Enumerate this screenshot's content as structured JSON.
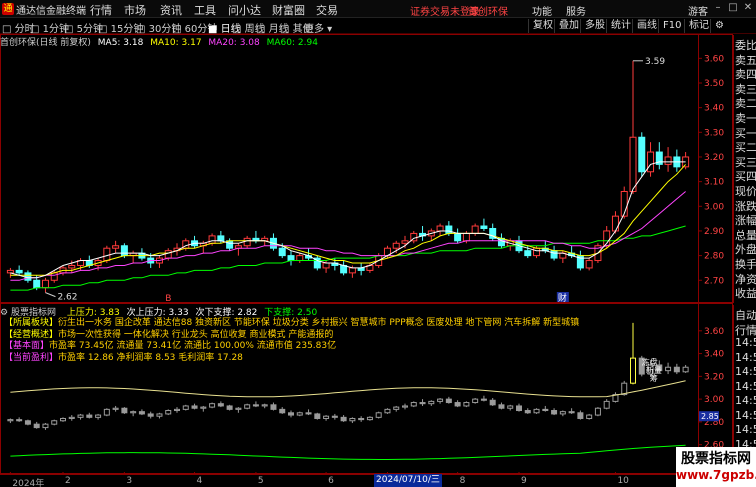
{
  "titlebar": {
    "app_title": "通达信金融终端",
    "menus": [
      "行情",
      "市场",
      "资讯",
      "工具",
      "问小达",
      "财富圈",
      "交易"
    ],
    "login_status": "证券交易未登录",
    "stock_title": "首创环保",
    "right_menus": [
      "功能",
      "服务",
      "游客"
    ],
    "window_buttons": [
      "minimize-icon",
      "restore-icon",
      "close-icon"
    ]
  },
  "toolbar": {
    "periods": [
      "分时",
      "1分钟",
      "5分钟",
      "15分钟",
      "30分钟",
      "60分钟",
      "日线",
      "周线",
      "月线",
      "其他",
      "更多"
    ],
    "active_period": "日线",
    "right_buttons": [
      "复权",
      "叠加",
      "多股",
      "统计",
      "画线",
      "F10",
      "标记"
    ]
  },
  "main_chart": {
    "header_name": "首创环保(日线 前复权)",
    "ma_labels": [
      {
        "text": "MA5: 3.18",
        "color": "#ffffff"
      },
      {
        "text": "MA10: 3.17",
        "color": "#ffff00"
      },
      {
        "text": "MA20: 3.08",
        "color": "#ff44ff"
      },
      {
        "text": "MA60: 2.94",
        "color": "#00ff00"
      }
    ],
    "y_ticks": [
      "3.60",
      "3.50",
      "3.40",
      "3.30",
      "3.20",
      "3.10",
      "3.00",
      "2.90",
      "2.80",
      "2.70"
    ],
    "high_label": "3.59",
    "low_label": "2.62",
    "markers": [
      "B",
      "财"
    ]
  },
  "indicator": {
    "header_name": "股票指标网",
    "labels": [
      {
        "text": "上压力: 3.83",
        "color": "#ffff00"
      },
      {
        "text": "次上压力: 3.33",
        "color": "#ffffff"
      },
      {
        "text": "次下支撑: 2.82",
        "color": "#ffffff"
      },
      {
        "text": "下支撑: 2.50",
        "color": "#00ff00"
      }
    ],
    "y_ticks": [
      "3.60",
      "3.40",
      "3.20",
      "3.00",
      "2.80",
      "2.60",
      "2.40"
    ],
    "cur_value": "2.85",
    "chip_labels": [
      "冻盘",
      "新量",
      "筹"
    ]
  },
  "info_box": [
    {
      "tag": "【所属板块】",
      "text": "衍生出一水务 国企改革 通达信88 独资新区 节能环保 垃圾分类 乡村振兴 智慧城市 PPP概念 医废处理 地下管网 汽车拆解 新型城镇",
      "tag_color": "#ffff00",
      "text_color": "#ffd000"
    },
    {
      "tag": "【经营概述】",
      "text": "市场一次性获得 一体化解决 行业龙头 高位收复 商业模式 产能通报的",
      "tag_color": "#ffff00",
      "text_color": "#ffd000"
    },
    {
      "tag": "【基本面】",
      "text": "市盈率 73.45亿 流通量 73.41亿 流通比 100.00% 流通市值 235.83亿",
      "tag_color": "#ff44ff",
      "text_color": "#ffd000"
    },
    {
      "tag": "【当前盈利】",
      "text": "市盈率 12.86 净利润率 8.53 毛利润率 17.28",
      "tag_color": "#ff44ff",
      "text_color": "#ffd000"
    }
  ],
  "quote_panel": [
    "委比",
    "卖五",
    "卖四",
    "卖三",
    "卖二",
    "卖一",
    "买一",
    "买二",
    "买三",
    "买四",
    "现价",
    "涨跌",
    "涨幅",
    "总量",
    "外盘",
    "换手",
    "净资",
    "收益"
  ],
  "tick_panel": [
    "自动",
    "行情",
    "14:56",
    "14:56",
    "14:56",
    "14:56",
    "14:56",
    "14:56",
    "14:56",
    "14:56",
    "14:56"
  ],
  "date_axis": {
    "labels": [
      "2024年",
      "2",
      "3",
      "4",
      "5",
      "6",
      "7",
      "8",
      "9",
      "10"
    ],
    "marker": "2024/07/10/三"
  },
  "watermark": {
    "name": "股票指标网",
    "url": "www.7gpzb.com"
  },
  "colors": {
    "up": "#ff3b3b",
    "down": "#54ffff",
    "grid": "#8b0000",
    "ma5": "#ffffff",
    "ma10": "#ffff00",
    "ma20": "#ff44ff",
    "ma60": "#00ff00"
  },
  "series": {
    "kline": [
      [
        2.73,
        2.75,
        2.71,
        2.74
      ],
      [
        2.74,
        2.76,
        2.72,
        2.73
      ],
      [
        2.73,
        2.74,
        2.69,
        2.7
      ],
      [
        2.7,
        2.72,
        2.66,
        2.67
      ],
      [
        2.67,
        2.71,
        2.65,
        2.7
      ],
      [
        2.7,
        2.74,
        2.69,
        2.73
      ],
      [
        2.73,
        2.76,
        2.72,
        2.75
      ],
      [
        2.75,
        2.78,
        2.73,
        2.76
      ],
      [
        2.76,
        2.79,
        2.74,
        2.78
      ],
      [
        2.78,
        2.8,
        2.75,
        2.76
      ],
      [
        2.76,
        2.79,
        2.74,
        2.78
      ],
      [
        2.78,
        2.84,
        2.77,
        2.83
      ],
      [
        2.83,
        2.86,
        2.81,
        2.84
      ],
      [
        2.84,
        2.85,
        2.79,
        2.8
      ],
      [
        2.8,
        2.82,
        2.77,
        2.81
      ],
      [
        2.81,
        2.83,
        2.78,
        2.79
      ],
      [
        2.79,
        2.81,
        2.75,
        2.77
      ],
      [
        2.77,
        2.8,
        2.75,
        2.79
      ],
      [
        2.79,
        2.83,
        2.78,
        2.82
      ],
      [
        2.82,
        2.85,
        2.8,
        2.83
      ],
      [
        2.83,
        2.87,
        2.82,
        2.86
      ],
      [
        2.86,
        2.88,
        2.83,
        2.84
      ],
      [
        2.84,
        2.86,
        2.81,
        2.85
      ],
      [
        2.85,
        2.89,
        2.84,
        2.88
      ],
      [
        2.88,
        2.9,
        2.85,
        2.86
      ],
      [
        2.86,
        2.87,
        2.82,
        2.83
      ],
      [
        2.83,
        2.85,
        2.8,
        2.84
      ],
      [
        2.84,
        2.88,
        2.83,
        2.87
      ],
      [
        2.87,
        2.9,
        2.85,
        2.86
      ],
      [
        2.86,
        2.88,
        2.84,
        2.87
      ],
      [
        2.87,
        2.89,
        2.82,
        2.83
      ],
      [
        2.83,
        2.85,
        2.79,
        2.8
      ],
      [
        2.8,
        2.82,
        2.76,
        2.78
      ],
      [
        2.78,
        2.81,
        2.77,
        2.8
      ],
      [
        2.8,
        2.83,
        2.78,
        2.79
      ],
      [
        2.79,
        2.8,
        2.74,
        2.75
      ],
      [
        2.75,
        2.78,
        2.73,
        2.77
      ],
      [
        2.77,
        2.79,
        2.74,
        2.76
      ],
      [
        2.76,
        2.78,
        2.72,
        2.73
      ],
      [
        2.73,
        2.76,
        2.71,
        2.75
      ],
      [
        2.75,
        2.77,
        2.72,
        2.74
      ],
      [
        2.74,
        2.77,
        2.73,
        2.76
      ],
      [
        2.76,
        2.81,
        2.75,
        2.8
      ],
      [
        2.8,
        2.84,
        2.79,
        2.83
      ],
      [
        2.83,
        2.86,
        2.81,
        2.85
      ],
      [
        2.85,
        2.88,
        2.83,
        2.86
      ],
      [
        2.86,
        2.9,
        2.85,
        2.89
      ],
      [
        2.89,
        2.92,
        2.86,
        2.88
      ],
      [
        2.88,
        2.91,
        2.86,
        2.9
      ],
      [
        2.9,
        2.93,
        2.88,
        2.92
      ],
      [
        2.92,
        2.94,
        2.88,
        2.89
      ],
      [
        2.89,
        2.91,
        2.85,
        2.86
      ],
      [
        2.86,
        2.9,
        2.85,
        2.89
      ],
      [
        2.89,
        2.93,
        2.88,
        2.92
      ],
      [
        2.92,
        2.95,
        2.9,
        2.91
      ],
      [
        2.91,
        2.93,
        2.86,
        2.87
      ],
      [
        2.87,
        2.89,
        2.83,
        2.84
      ],
      [
        2.84,
        2.87,
        2.82,
        2.86
      ],
      [
        2.86,
        2.88,
        2.81,
        2.82
      ],
      [
        2.82,
        2.84,
        2.79,
        2.8
      ],
      [
        2.8,
        2.84,
        2.79,
        2.83
      ],
      [
        2.83,
        2.86,
        2.81,
        2.82
      ],
      [
        2.82,
        2.84,
        2.78,
        2.79
      ],
      [
        2.79,
        2.82,
        2.77,
        2.81
      ],
      [
        2.81,
        2.84,
        2.79,
        2.8
      ],
      [
        2.8,
        2.82,
        2.74,
        2.75
      ],
      [
        2.75,
        2.79,
        2.74,
        2.78
      ],
      [
        2.78,
        2.85,
        2.77,
        2.84
      ],
      [
        2.84,
        2.92,
        2.83,
        2.9
      ],
      [
        2.9,
        2.98,
        2.89,
        2.96
      ],
      [
        2.96,
        3.08,
        2.95,
        3.06
      ],
      [
        3.06,
        3.59,
        3.05,
        3.28
      ],
      [
        3.28,
        3.3,
        3.12,
        3.14
      ],
      [
        3.14,
        3.26,
        3.12,
        3.22
      ],
      [
        3.22,
        3.26,
        3.15,
        3.17
      ],
      [
        3.17,
        3.24,
        3.14,
        3.2
      ],
      [
        3.2,
        3.23,
        3.14,
        3.16
      ],
      [
        3.16,
        3.22,
        3.15,
        3.2
      ]
    ],
    "ma5": [
      2.73,
      2.72,
      2.71,
      2.71,
      2.72,
      2.74,
      2.76,
      2.77,
      2.78,
      2.78,
      2.79,
      2.8,
      2.81,
      2.81,
      2.81,
      2.81,
      2.8,
      2.8,
      2.81,
      2.82,
      2.84,
      2.85,
      2.85,
      2.86,
      2.86,
      2.85,
      2.85,
      2.86,
      2.86,
      2.86,
      2.85,
      2.84,
      2.82,
      2.81,
      2.8,
      2.78,
      2.77,
      2.77,
      2.76,
      2.75,
      2.75,
      2.76,
      2.78,
      2.8,
      2.82,
      2.84,
      2.87,
      2.88,
      2.89,
      2.9,
      2.9,
      2.89,
      2.89,
      2.89,
      2.89,
      2.88,
      2.86,
      2.85,
      2.84,
      2.83,
      2.82,
      2.82,
      2.81,
      2.81,
      2.8,
      2.79,
      2.79,
      2.81,
      2.85,
      2.9,
      2.97,
      3.07,
      3.12,
      3.17,
      3.18,
      3.18,
      3.18,
      3.18
    ],
    "ma10": [
      2.72,
      2.72,
      2.72,
      2.72,
      2.72,
      2.73,
      2.74,
      2.74,
      2.75,
      2.76,
      2.77,
      2.78,
      2.79,
      2.8,
      2.8,
      2.8,
      2.8,
      2.81,
      2.81,
      2.82,
      2.83,
      2.83,
      2.84,
      2.85,
      2.85,
      2.86,
      2.86,
      2.86,
      2.86,
      2.86,
      2.85,
      2.84,
      2.83,
      2.82,
      2.81,
      2.8,
      2.79,
      2.78,
      2.78,
      2.77,
      2.77,
      2.77,
      2.78,
      2.79,
      2.8,
      2.82,
      2.83,
      2.85,
      2.86,
      2.88,
      2.89,
      2.89,
      2.89,
      2.89,
      2.89,
      2.88,
      2.87,
      2.86,
      2.85,
      2.84,
      2.83,
      2.83,
      2.82,
      2.82,
      2.81,
      2.8,
      2.8,
      2.81,
      2.83,
      2.86,
      2.89,
      2.94,
      2.98,
      3.02,
      3.06,
      3.1,
      3.13,
      3.17
    ],
    "ma20": [
      2.7,
      2.7,
      2.71,
      2.71,
      2.72,
      2.72,
      2.73,
      2.73,
      2.74,
      2.74,
      2.75,
      2.75,
      2.76,
      2.76,
      2.77,
      2.77,
      2.78,
      2.78,
      2.79,
      2.79,
      2.8,
      2.8,
      2.81,
      2.81,
      2.82,
      2.82,
      2.83,
      2.83,
      2.83,
      2.84,
      2.84,
      2.84,
      2.84,
      2.83,
      2.83,
      2.83,
      2.82,
      2.82,
      2.81,
      2.81,
      2.8,
      2.8,
      2.8,
      2.8,
      2.8,
      2.81,
      2.81,
      2.82,
      2.83,
      2.84,
      2.85,
      2.85,
      2.86,
      2.86,
      2.86,
      2.86,
      2.86,
      2.86,
      2.86,
      2.86,
      2.86,
      2.86,
      2.85,
      2.85,
      2.84,
      2.84,
      2.83,
      2.83,
      2.84,
      2.85,
      2.87,
      2.89,
      2.91,
      2.94,
      2.97,
      3.0,
      3.03,
      3.06
    ],
    "ma60": [
      2.66,
      2.66,
      2.66,
      2.67,
      2.67,
      2.67,
      2.68,
      2.68,
      2.68,
      2.69,
      2.69,
      2.7,
      2.7,
      2.7,
      2.71,
      2.71,
      2.72,
      2.72,
      2.72,
      2.73,
      2.73,
      2.74,
      2.74,
      2.74,
      2.75,
      2.75,
      2.76,
      2.76,
      2.76,
      2.77,
      2.77,
      2.77,
      2.78,
      2.78,
      2.78,
      2.78,
      2.78,
      2.79,
      2.79,
      2.79,
      2.79,
      2.79,
      2.8,
      2.8,
      2.8,
      2.8,
      2.81,
      2.81,
      2.81,
      2.82,
      2.82,
      2.82,
      2.82,
      2.83,
      2.83,
      2.83,
      2.83,
      2.84,
      2.84,
      2.84,
      2.84,
      2.84,
      2.85,
      2.85,
      2.85,
      2.85,
      2.85,
      2.86,
      2.86,
      2.86,
      2.87,
      2.87,
      2.88,
      2.88,
      2.89,
      2.9,
      2.91,
      2.92
    ]
  }
}
